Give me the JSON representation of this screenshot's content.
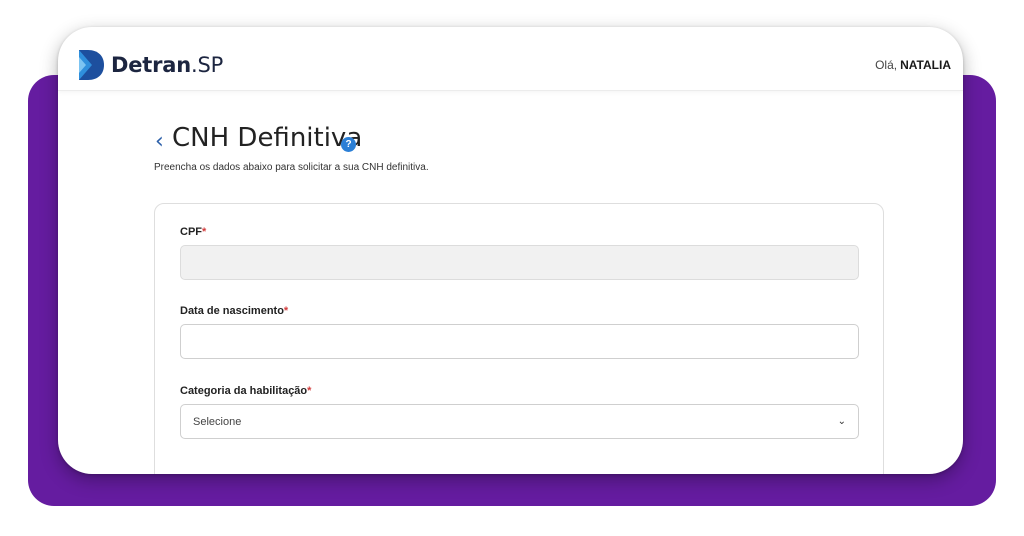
{
  "colors": {
    "purple_panel": "#651ca0",
    "accent_blue": "#2b7fd6",
    "required_red": "#d23c3c"
  },
  "header": {
    "logo_icon": "detran-d-logo-icon",
    "logo_name": "Detran",
    "logo_suffix": ".SP",
    "greeting_prefix": "Olá,",
    "user_name": "NATALIA"
  },
  "page": {
    "back_icon": "chevron-left-icon",
    "title": "CNH Definitiva",
    "help_icon": "question-circle-icon",
    "help_glyph": "?",
    "subtitle": "Preencha os dados abaixo para solicitar a sua CNH definitiva."
  },
  "form": {
    "required_marker": "*",
    "cpf": {
      "label": "CPF",
      "value": ""
    },
    "birth_date": {
      "label": "Data de nascimento",
      "value": ""
    },
    "license_category": {
      "label": "Categoria da habilitação",
      "selected": "Selecione",
      "caret_icon": "chevron-down-icon",
      "caret_glyph": "⌄"
    }
  }
}
